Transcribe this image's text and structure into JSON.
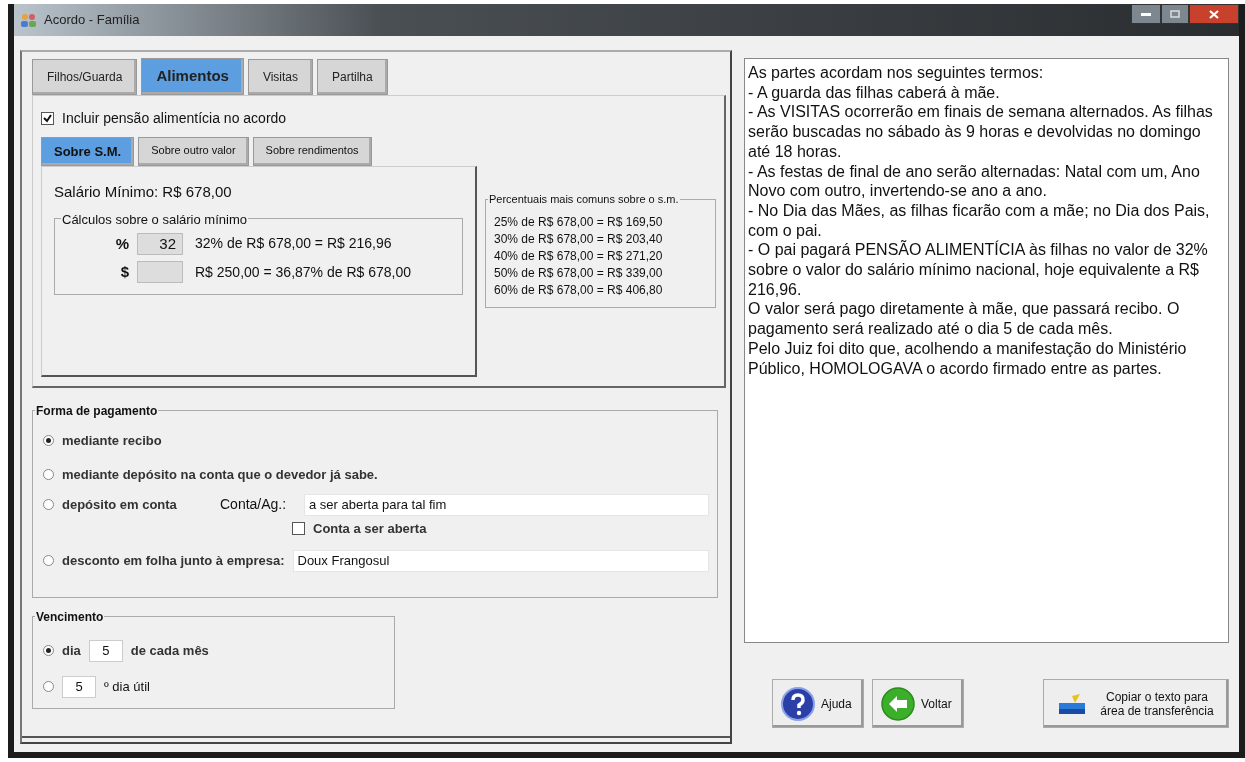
{
  "window": {
    "title": "Acordo - Família"
  },
  "tabs": [
    {
      "label": "Filhos/Guarda",
      "selected": false
    },
    {
      "label": "Alimentos",
      "selected": true
    },
    {
      "label": "Visitas",
      "selected": false
    },
    {
      "label": "Partilha",
      "selected": false
    }
  ],
  "include_checkbox": {
    "label": "Incluir pensão alimentícia no acordo",
    "checked": true
  },
  "sub_tabs": [
    {
      "label": "Sobre S.M.",
      "selected": true
    },
    {
      "label": "Sobre outro valor",
      "selected": false
    },
    {
      "label": "Sobre rendimentos",
      "selected": false
    }
  ],
  "minimum_wage": "Salário Mínimo: R$ 678,00",
  "calculations": {
    "title": "Cálculos sobre o salário mínimo",
    "rows": [
      {
        "symbol": "%",
        "value": "32",
        "result": "32% de R$ 678,00 = R$ 216,96"
      },
      {
        "symbol": "$",
        "value": "",
        "result": "R$ 250,00 = 36,87% de R$ 678,00"
      }
    ]
  },
  "common_percentages": {
    "title": "Percentuais mais comuns sobre o s.m.",
    "lines": [
      "25% de R$ 678,00 = R$ 169,50",
      "30% de R$ 678,00 = R$ 203,40",
      "40% de R$ 678,00 = R$ 271,20",
      "50% de R$ 678,00 = R$ 339,00",
      "60% de R$ 678,00 = R$ 406,80"
    ]
  },
  "payment": {
    "title": "Forma de pagamento",
    "options": [
      {
        "kind": "plain",
        "label": "mediante recibo",
        "selected": true
      },
      {
        "kind": "plain",
        "label": "mediante depósito na conta que o devedor já sabe.",
        "selected": false
      },
      {
        "kind": "account",
        "label": "depósito em conta",
        "selected": false,
        "field_label": "Conta/Ag.:",
        "field_value": "a ser aberta para tal fim",
        "checkbox": {
          "label": "Conta a ser aberta",
          "checked": false
        }
      },
      {
        "kind": "employer",
        "label": "desconto em folha junto à empresa:",
        "selected": false,
        "field_value": "Doux Frangosul"
      }
    ]
  },
  "due_date": {
    "title": "Vencimento",
    "options": [
      {
        "kind": "day",
        "selected": true,
        "prefix": "dia",
        "value": "5",
        "suffix": "de cada mês"
      },
      {
        "kind": "business_day",
        "selected": false,
        "value": "5",
        "suffix": "º dia útil"
      }
    ]
  },
  "agreement_text": [
    "As partes acordam nos seguintes termos:",
    "- A guarda das filhas caberá à mãe.",
    "- As VISITAS ocorrerão em finais de semana alternados. As filhas serão buscadas no sábado às 9 horas e devolvidas no domingo até 18 horas.",
    "- As festas de final de ano serão alternadas: Natal com um, Ano Novo com outro, invertendo-se ano a ano.",
    "- No Dia das Mães, as filhas ficarão com a mãe; no Dia dos Pais, com o pai.",
    "- O pai pagará PENSÃO ALIMENTÍCIA às filhas no valor de 32% sobre o valor do salário mínimo nacional, hoje equivalente a R$ 216,96.",
    "O valor será pago diretamente à mãe, que passará recibo. O pagamento será realizado até o dia 5 de cada mês.",
    "Pelo Juiz foi dito que, acolhendo a manifestação do Ministério Público, HOMOLOGAVA o acordo firmado entre as partes."
  ],
  "buttons": [
    {
      "kind": "help",
      "label": "Ajuda"
    },
    {
      "kind": "back",
      "label": "Voltar"
    },
    {
      "kind": "copy",
      "label": "Copiar o texto para\nárea de transferência"
    }
  ]
}
